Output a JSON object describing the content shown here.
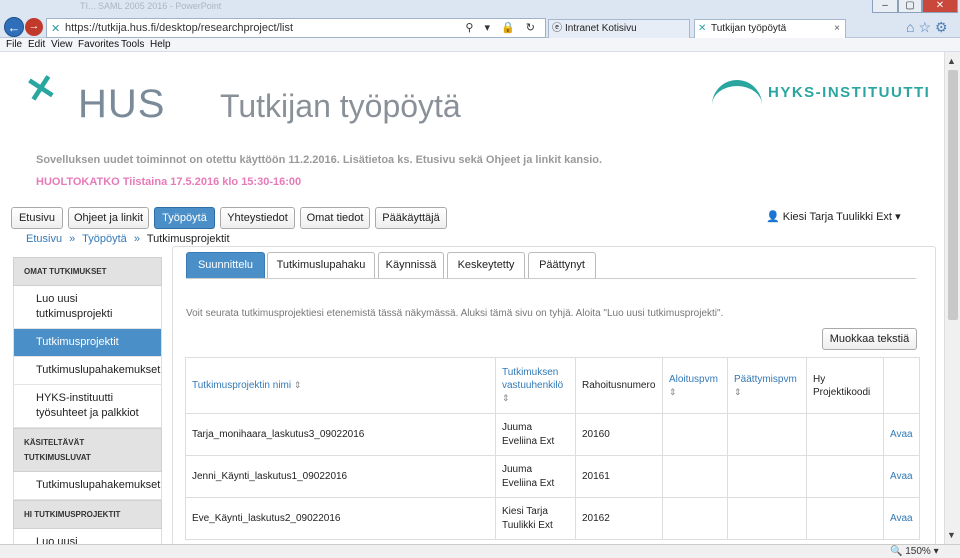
{
  "browser": {
    "faded_title": "TI... SAML 2005 2016 - PowerPoint",
    "url": "https://tutkija.hus.fi/desktop/researchproject/list",
    "address_tools": "⚲ ▾ 🔒 ↻",
    "tabs": [
      {
        "label": "Intranet Kotisivu"
      },
      {
        "label": "Tutkijan työpöytä"
      }
    ],
    "menu": [
      "File",
      "Edit",
      "View",
      "Favorites",
      "Tools",
      "Help"
    ],
    "zoom": "150%"
  },
  "header": {
    "hus_logo_text": "HUS",
    "app_title": "Tutkijan työpöytä",
    "hyks_logo_text": "HYKS-INSTITUUTTI"
  },
  "notice": "Sovelluksen uudet toiminnot on otettu käyttöön 11.2.2016. Lisätietoa ks. Etusivu sekä Ohjeet ja linkit kansio.",
  "maintenance": "HUOLTOKATKO Tiistaina 17.5.2016 klo 15:30-16:00",
  "main_nav": [
    "Etusivu",
    "Ohjeet ja linkit",
    "Työpöytä",
    "Yhteystiedot",
    "Omat tiedot",
    "Pääkäyttäjä"
  ],
  "user": "Kiesi Tarja Tuulikki Ext",
  "breadcrumb": {
    "items": [
      "Etusivu",
      "Työpöytä"
    ],
    "separator": "»",
    "current": "Tutkimusprojektit"
  },
  "sidebar": {
    "section1": "OMAT TUTKIMUKSET",
    "section1_items": [
      "Luo uusi tutkimusprojekti",
      "Tutkimusprojektit",
      "Tutkimuslupahakemukset",
      "HYKS-instituutti työsuhteet ja palkkiot"
    ],
    "section2": "KÄSITELTÄVÄT TUTKIMUSLUVAT",
    "section2_items": [
      "Tutkimuslupahakemukset"
    ],
    "section3": "HI TUTKIMUSPROJEKTIT",
    "section3_items": [
      "Luo uusi tutkimusprojekti"
    ]
  },
  "subtabs": [
    "Suunnittelu",
    "Tutkimuslupahaku",
    "Käynnissä",
    "Keskeytetty",
    "Päättynyt"
  ],
  "intro_text": "Voit seurata tutkimusprojektiesi etenemistä tässä näkymässä. Aluksi tämä sivu on tyhjä. Aloita \"Luo uusi tutkimusprojekti\".",
  "edit_text_button": "Muokkaa tekstiä",
  "table": {
    "headers": [
      "Tutkimusprojektin nimi",
      "Tutkimuksen vastuuhenkilö",
      "Rahoitusnumero",
      "Aloituspvm",
      "Päättymispvm",
      "Hy Projektikoodi"
    ],
    "rows": [
      {
        "name": "Tarja_monihaara_laskutus3_09022016",
        "owner": "Juuma Eveliina Ext",
        "funding": "20160",
        "start": "",
        "end": "",
        "code": "",
        "action": "Avaa"
      },
      {
        "name": "Jenni_Käynti_laskutus1_09022016",
        "owner": "Juuma Eveliina Ext",
        "funding": "20161",
        "start": "",
        "end": "",
        "code": "",
        "action": "Avaa"
      },
      {
        "name": "Eve_Käynti_laskutus2_09022016",
        "owner": "Kiesi Tarja Tuulikki Ext",
        "funding": "20162",
        "start": "",
        "end": "",
        "code": "",
        "action": "Avaa"
      }
    ]
  },
  "colors": {
    "accent": "#4a8fc8",
    "link": "#337ab7",
    "brand_teal": "#2aa6a0",
    "maintenance": "#e67bb8"
  }
}
